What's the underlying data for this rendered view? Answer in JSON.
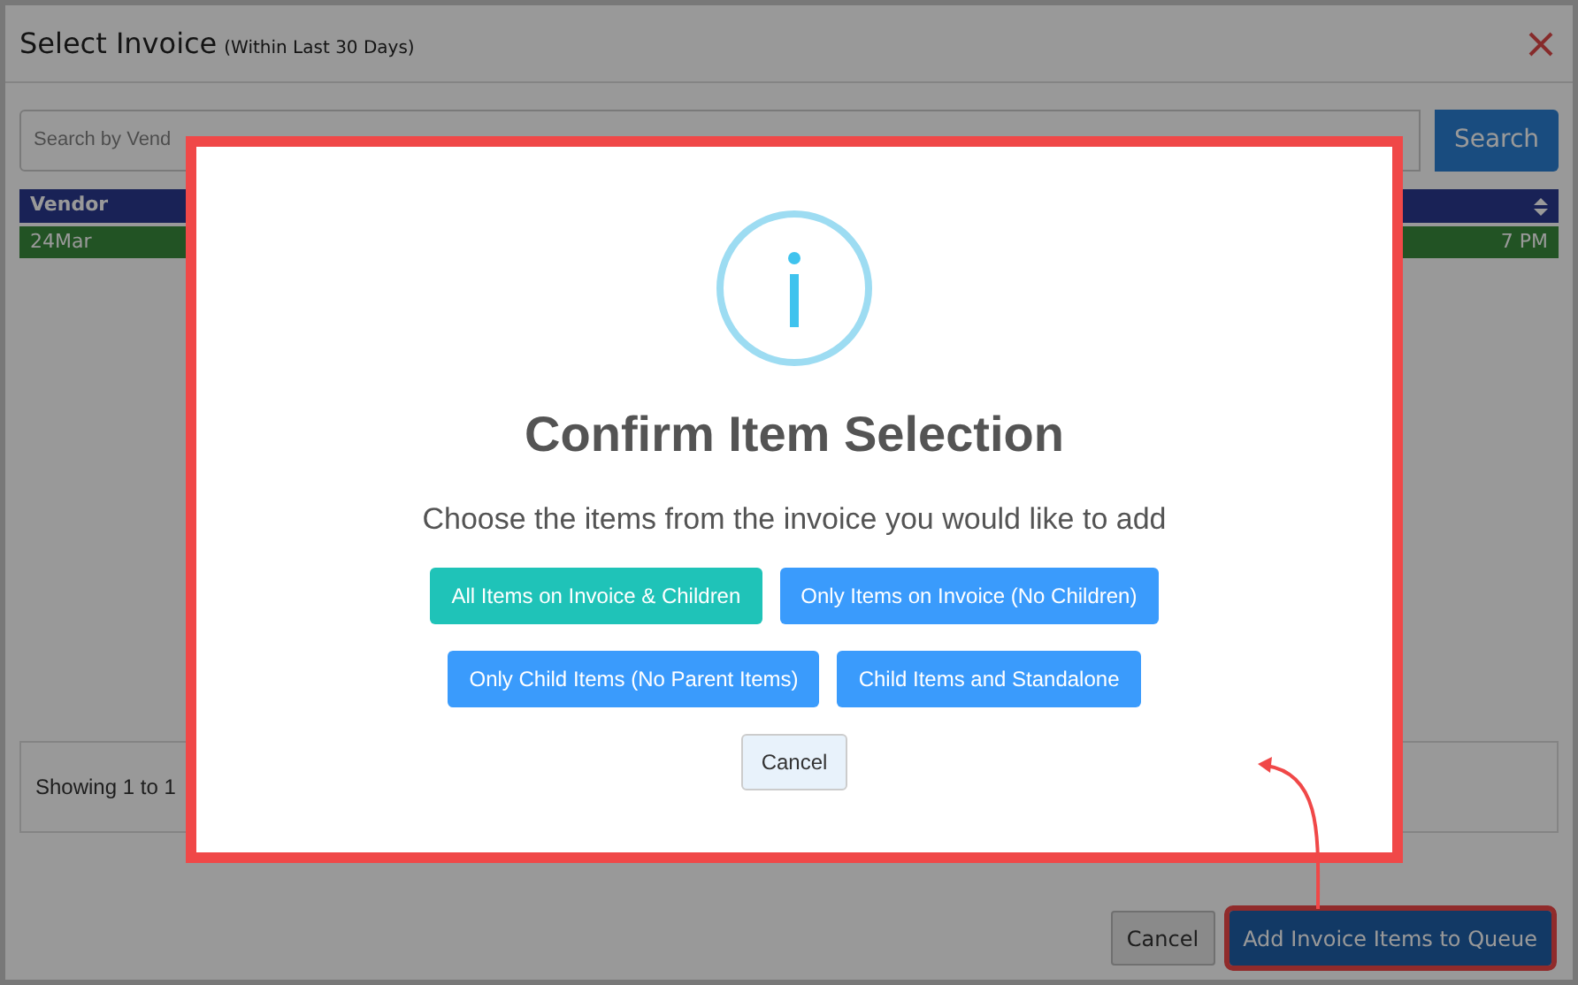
{
  "dialog": {
    "title": "Select Invoice",
    "subtitle": "(Within Last 30 Days)",
    "search": {
      "placeholder": "Search by Vend"
    },
    "search_button": "Search",
    "table": {
      "columns": [
        "Vendor"
      ],
      "rows": [
        {
          "cells": [
            "24Mar",
            "7 PM"
          ],
          "selected": true
        }
      ]
    },
    "footer_text": "Showing 1 to 1",
    "buttons": [
      {
        "label": "Cancel",
        "kind": "default",
        "highlighted": false
      },
      {
        "label": "Add Invoice Items to Queue",
        "kind": "primary",
        "highlighted": true
      }
    ]
  },
  "modal": {
    "title": "Confirm Item Selection",
    "message": "Choose the items from the invoice you would like to add",
    "option_rows": [
      [
        {
          "label": "All Items on Invoice & Children",
          "kind": "teal"
        },
        {
          "label": "Only Items on Invoice (No Children)",
          "kind": "blue"
        }
      ],
      [
        {
          "label": "Only Child Items (No Parent Items)",
          "kind": "blue"
        },
        {
          "label": "Child Items and Standalone",
          "kind": "blue"
        }
      ]
    ],
    "cancel": "Cancel",
    "highlighted": true
  }
}
